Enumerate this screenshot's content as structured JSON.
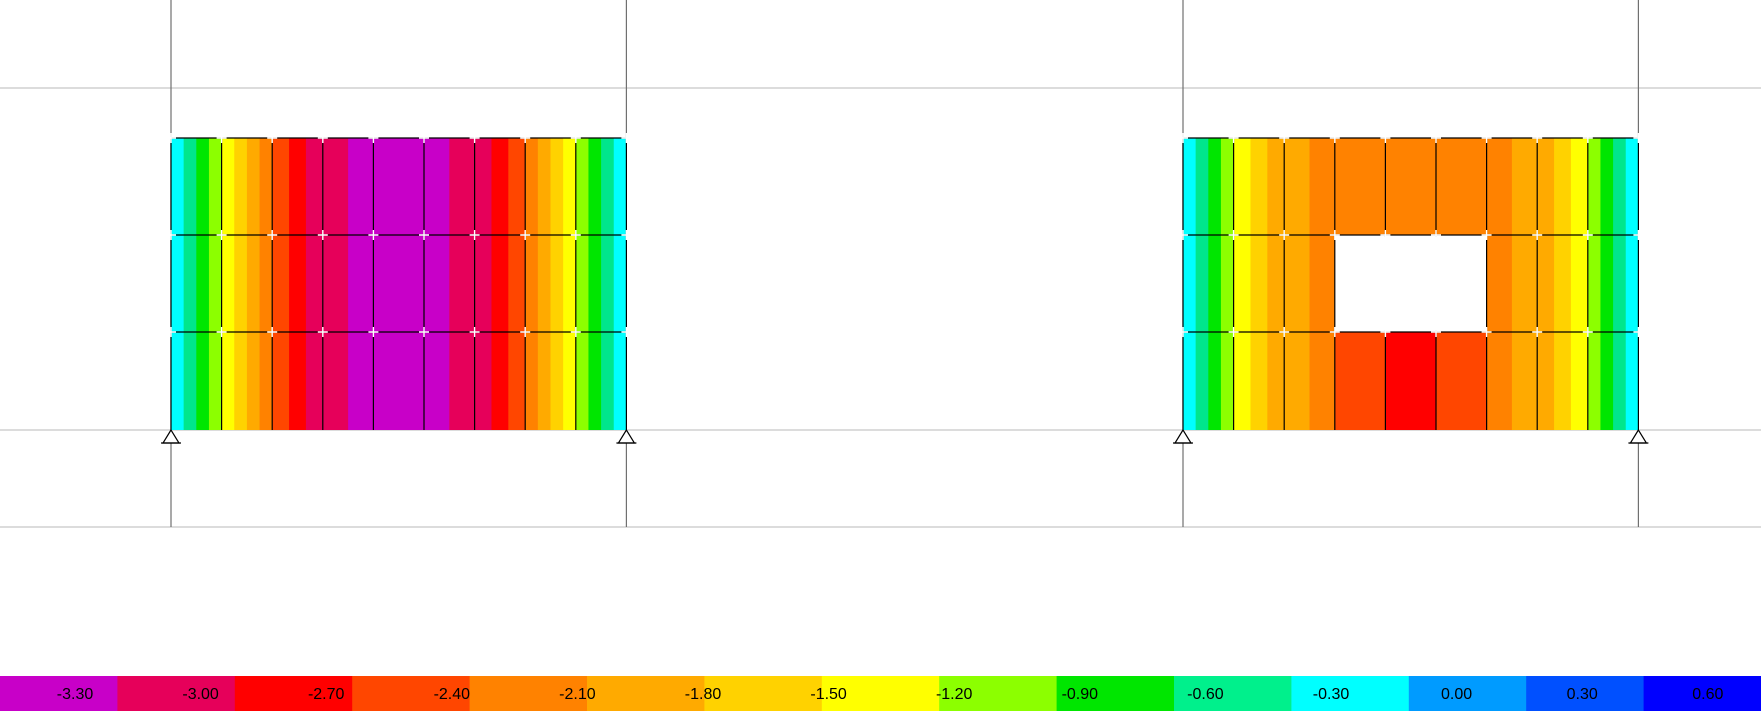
{
  "view": {
    "background": "#ffffff",
    "grid_color": "#c8c8c8",
    "mesh_line_color": "#000000",
    "node_color": "#ffffff"
  },
  "colormap": {
    "bands": [
      "#c800c8",
      "#e6005a",
      "#ff0000",
      "#ff4600",
      "#ff8200",
      "#ffaa00",
      "#ffd200",
      "#ffff00",
      "#8cff00",
      "#00e600",
      "#00f08c",
      "#00ffff",
      "#009bff",
      "#0050ff",
      "#0000ff"
    ]
  },
  "walls": [
    {
      "name": "wall-left",
      "supports": [
        "pin-support-icon",
        "pin-support-icon"
      ],
      "columns": [
        [
          "#00ffff",
          "#00e68c",
          "#00e600",
          "#8cff00"
        ],
        [
          "#ffff00",
          "#ffd200",
          "#ffaa00",
          "#ff8200"
        ],
        [
          "#ff4600",
          "#ff0000",
          "#e6005a"
        ],
        [
          "#e6005a",
          "#c800c8"
        ],
        [
          "#c800c8"
        ],
        [
          "#c800c8",
          "#e6005a"
        ],
        [
          "#e6005a",
          "#ff0000",
          "#ff4600"
        ],
        [
          "#ff8200",
          "#ffaa00",
          "#ffd200",
          "#ffff00"
        ],
        [
          "#8cff00",
          "#00e600",
          "#00e68c",
          "#00ffff"
        ]
      ],
      "openings": []
    },
    {
      "name": "wall-right",
      "supports": [
        "pin-support-icon",
        "pin-support-icon"
      ],
      "columns": [
        [
          "#00ffff",
          "#00e68c",
          "#00e600",
          "#8cff00"
        ],
        [
          "#ffff00",
          "#ffd200",
          "#ffaa00"
        ],
        [
          "#ffaa00",
          "#ff8200"
        ],
        [
          "#ff8200"
        ],
        [
          "#ff8200"
        ],
        [
          "#ff8200"
        ],
        [
          "#ff8200",
          "#ffaa00"
        ],
        [
          "#ffaa00",
          "#ffd200",
          "#ffff00"
        ],
        [
          "#8cff00",
          "#00e600",
          "#00e68c",
          "#00ffff"
        ]
      ],
      "bottom_overrides": [
        {
          "col": 3,
          "color": "#ff4600"
        },
        {
          "col": 4,
          "color": "#ff0000"
        },
        {
          "col": 5,
          "color": "#ff4600"
        }
      ],
      "openings": [
        {
          "col_start": 3,
          "col_end": 5,
          "row": 1
        }
      ]
    }
  ],
  "legend": {
    "labels": [
      "-3.30",
      "-3.00",
      "-2.70",
      "-2.40",
      "-2.10",
      "-1.80",
      "-1.50",
      "-1.20",
      "-0.90",
      "-0.60",
      "-0.30",
      "0.00",
      "0.30",
      "0.60"
    ]
  }
}
